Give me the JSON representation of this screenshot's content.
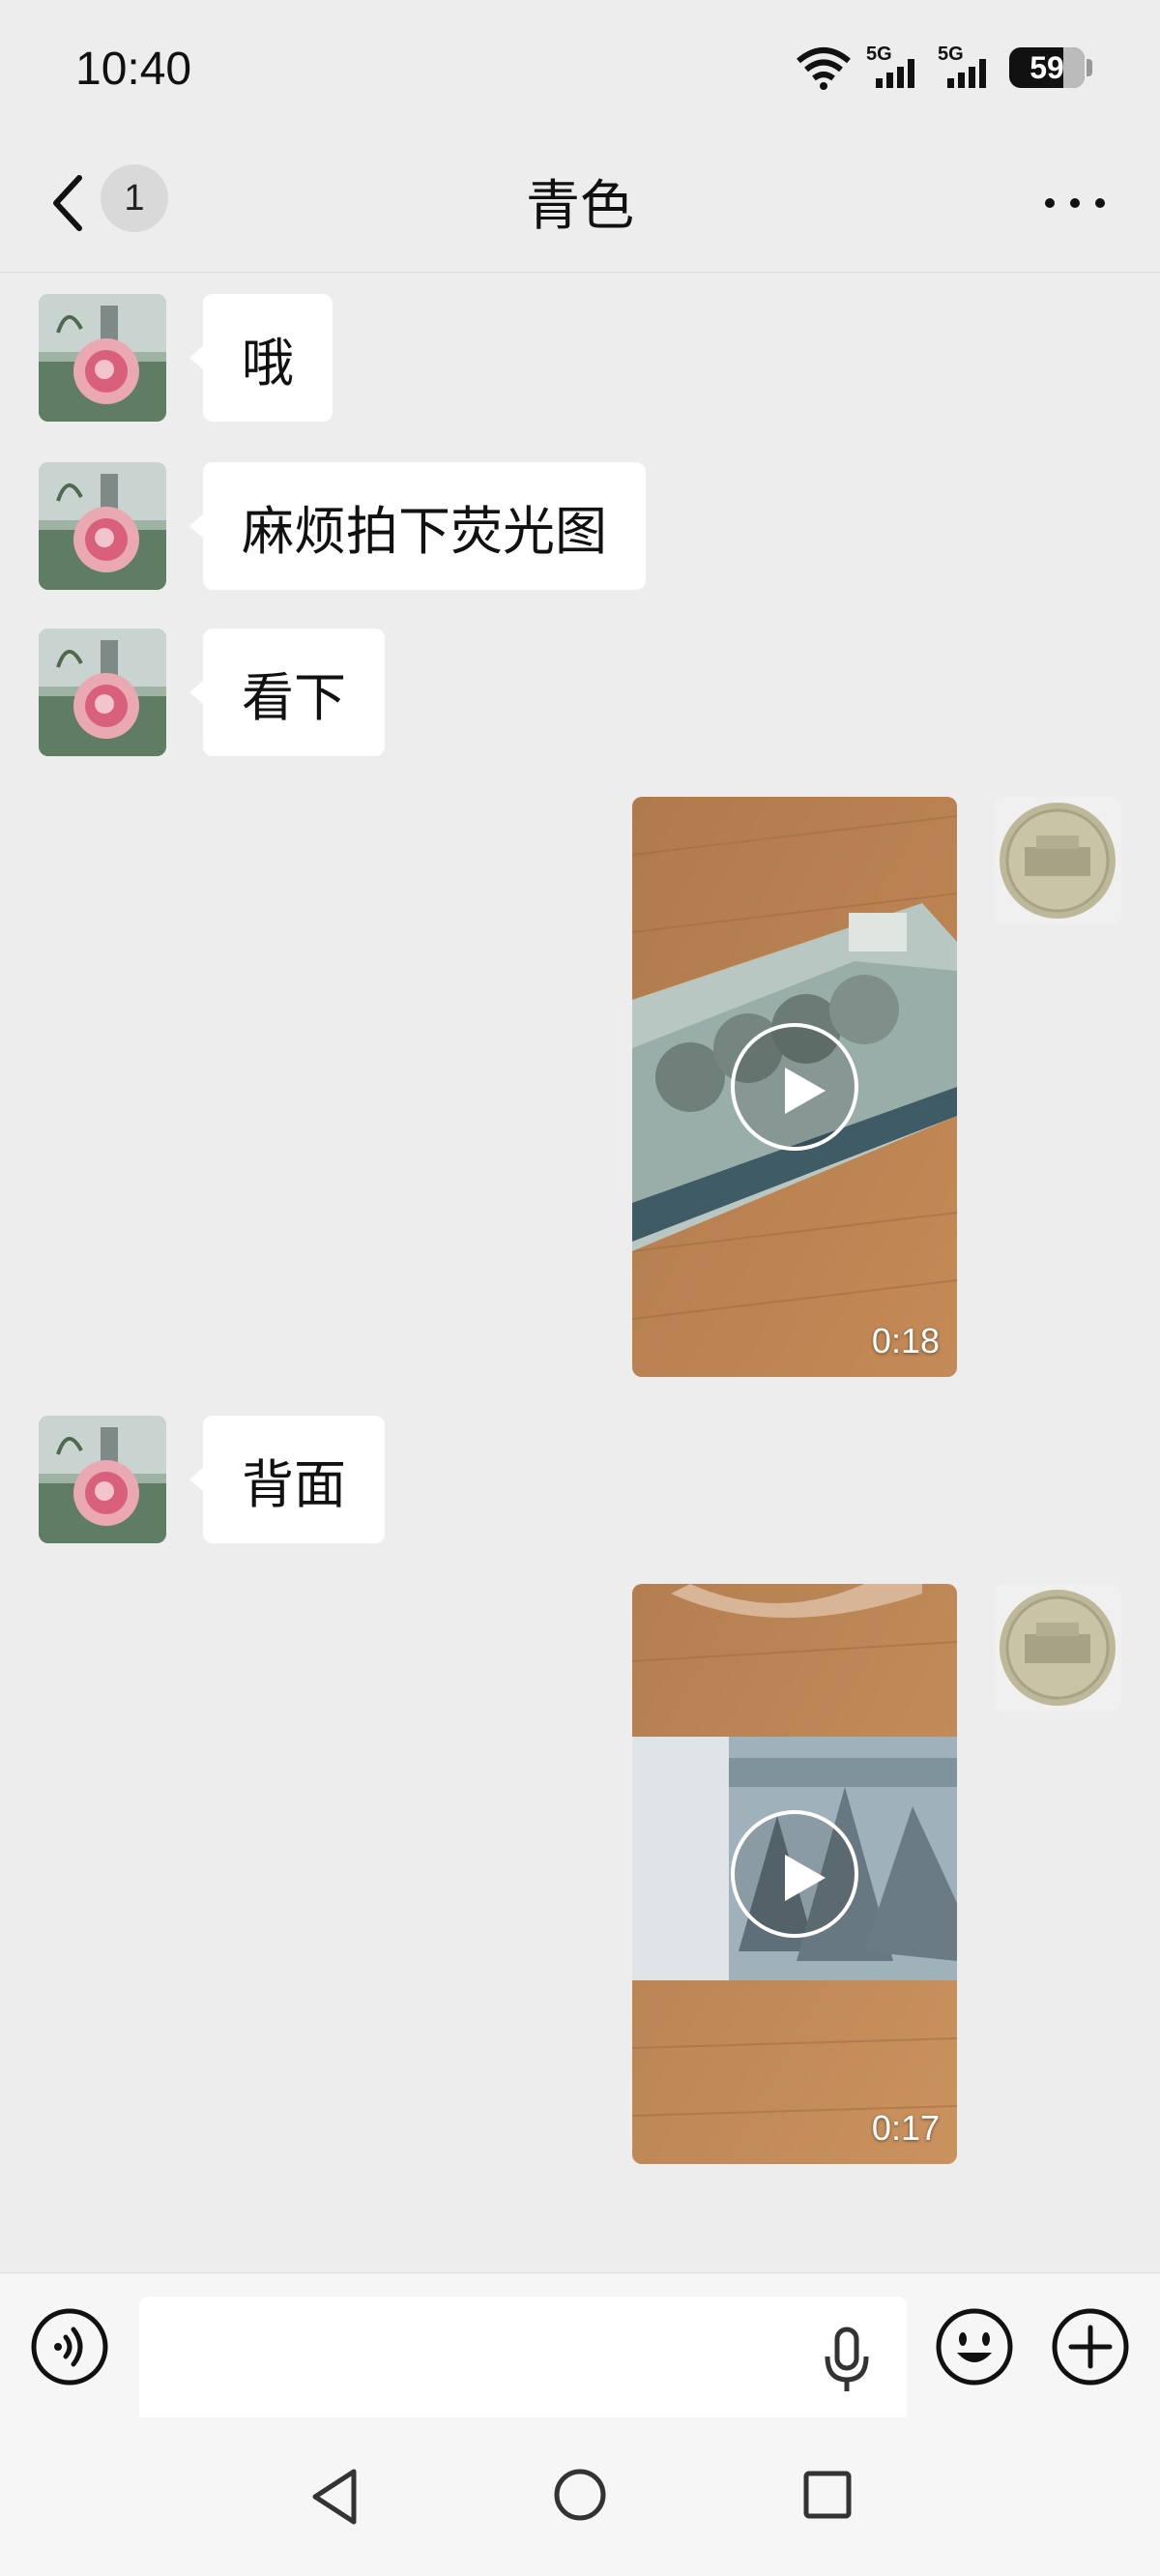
{
  "status": {
    "time": "10:40",
    "battery": "59",
    "signal_1": "5G",
    "signal_2": "5G"
  },
  "header": {
    "title": "青色",
    "unread_count": "1",
    "icons": [
      "back-chevron",
      "more-dots"
    ]
  },
  "messages": [
    {
      "side": "left",
      "type": "text",
      "text": "哦"
    },
    {
      "side": "left",
      "type": "text",
      "text": "麻烦拍下荧光图"
    },
    {
      "side": "left",
      "type": "text",
      "text": "看下"
    },
    {
      "side": "right",
      "type": "video",
      "duration": "0:18"
    },
    {
      "side": "left",
      "type": "text",
      "text": "背面"
    },
    {
      "side": "right",
      "type": "video",
      "duration": "0:17"
    }
  ],
  "input": {
    "placeholder": "",
    "value": "",
    "icons": [
      "voice-icon",
      "mic-icon",
      "emoji-icon",
      "plus-icon"
    ]
  },
  "nav": {
    "icons": [
      "nav-back-icon",
      "nav-home-icon",
      "nav-recent-icon"
    ]
  },
  "colors": {
    "background": "#ededed",
    "bubble": "#ffffff",
    "bar": "#f6f6f6"
  }
}
